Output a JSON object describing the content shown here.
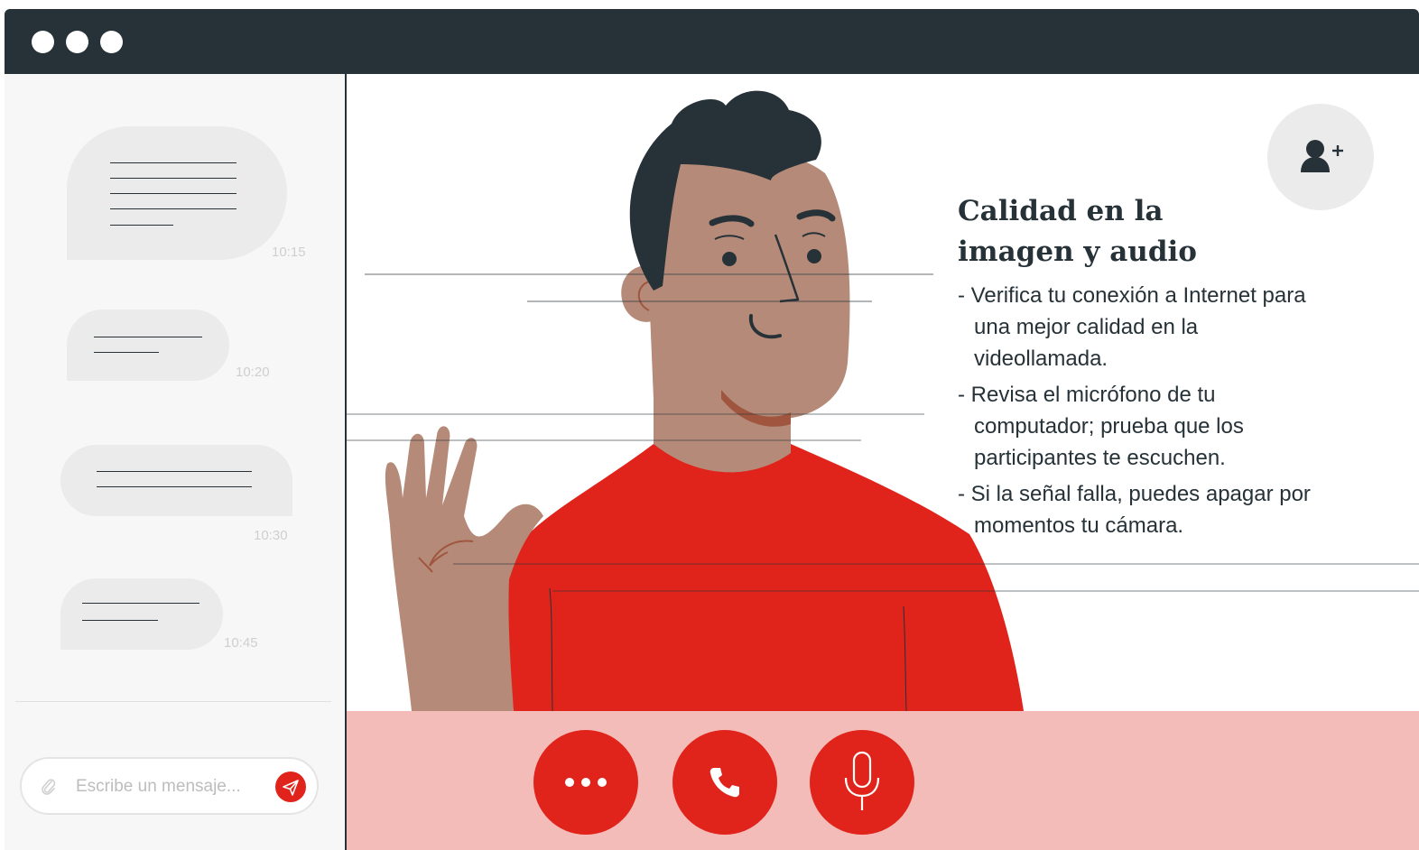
{
  "window": {
    "controls": [
      "dot",
      "dot",
      "dot"
    ]
  },
  "chat": {
    "messages": [
      {
        "time": "10:15"
      },
      {
        "time": "10:20"
      },
      {
        "time": "10:30"
      },
      {
        "time": "10:45"
      }
    ],
    "composer": {
      "placeholder": "Escribe un mensaje...",
      "attach_icon": "paperclip-icon",
      "send_icon": "send-icon"
    }
  },
  "tip": {
    "title_line1": "Calidad en la",
    "title_line2": "imagen y audio",
    "items": [
      "Verifica tu conexión a Internet para una mejor calidad en la videollamada.",
      "Revisa el micrófono de tu computador; prueba que los participantes te escuchen.",
      "Si la señal falla, puedes apagar por momentos tu cámara."
    ]
  },
  "call_controls": {
    "more_icon": "more-icon",
    "call_icon": "phone-icon",
    "mic_icon": "microphone-icon",
    "add_user_icon": "add-user-icon"
  },
  "colors": {
    "accent": "#e0241b",
    "dark": "#263238",
    "controls_bg": "#f4bcb9",
    "skin": "#b58a78",
    "bubble": "#ebebeb"
  }
}
